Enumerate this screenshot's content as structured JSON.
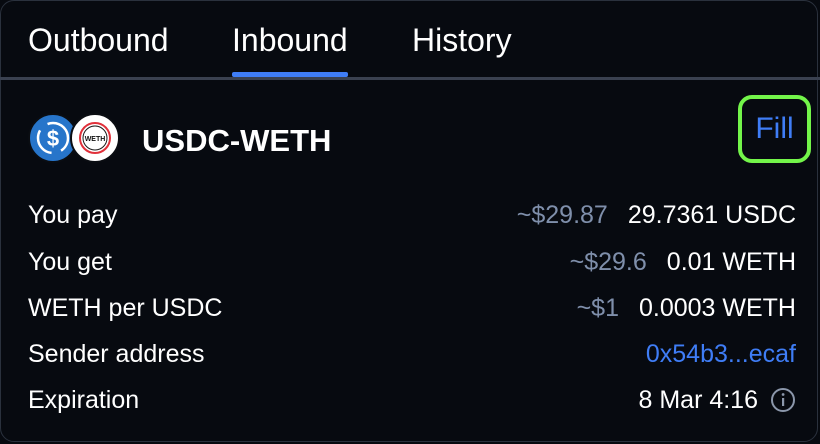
{
  "tabs": [
    "Outbound",
    "Inbound",
    "History"
  ],
  "active_tab": "Inbound",
  "order": {
    "pair": "USDC-WETH",
    "fill_label": "Fill",
    "token_a": {
      "symbol": "USDC",
      "icon": "usdc-icon",
      "color": "#2775ca"
    },
    "token_b": {
      "symbol": "WETH",
      "icon": "weth-icon",
      "badge_text": "WETH"
    },
    "rows": [
      {
        "label": "You pay",
        "usd": "~$29.87",
        "amount": "29.7361 USDC"
      },
      {
        "label": "You get",
        "usd": "~$29.6",
        "amount": "0.01 WETH"
      },
      {
        "label": "WETH per USDC",
        "usd": "~$1",
        "amount": "0.0003 WETH"
      },
      {
        "label": "Sender address",
        "value": "0x54b3...ecaf"
      },
      {
        "label": "Expiration",
        "value": "8 Mar 4:16",
        "icon": "info-icon"
      }
    ]
  },
  "colors": {
    "accent": "#3f7df6",
    "highlight": "#73f54a",
    "muted": "#7f8fab",
    "background": "#070a10"
  }
}
